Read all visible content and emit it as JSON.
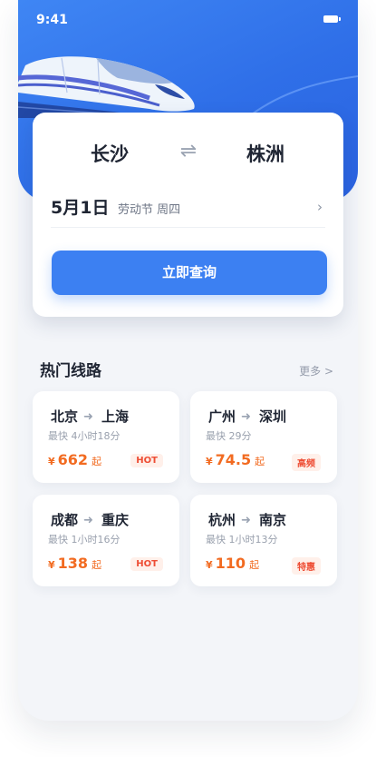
{
  "status_bar": {
    "time": "9:41"
  },
  "search": {
    "from_city": "长沙",
    "to_city": "株洲",
    "date": "5月1日",
    "date_note": "劳动节 周四",
    "search_button_label": "立即查询"
  },
  "popular": {
    "title": "热门线路",
    "more_label": "更多 >",
    "routes": [
      {
        "from": "北京",
        "to": "上海",
        "fastest": "最快 4小时18分",
        "currency": "¥",
        "price": "662",
        "price_suffix": "起",
        "badge": "HOT"
      },
      {
        "from": "广州",
        "to": "深圳",
        "fastest": "最快 29分",
        "currency": "¥",
        "price": "74.5",
        "price_suffix": "起",
        "badge": "高频"
      },
      {
        "from": "成都",
        "to": "重庆",
        "fastest": "最快 1小时16分",
        "currency": "¥",
        "price": "138",
        "price_suffix": "起",
        "badge": "HOT"
      },
      {
        "from": "杭州",
        "to": "南京",
        "fastest": "最快 1小时13分",
        "currency": "¥",
        "price": "110",
        "price_suffix": "起",
        "badge": "特惠"
      }
    ]
  },
  "icons": {
    "battery": "battery-icon",
    "swap": "swap-icon",
    "chevron": "chevron-right-icon",
    "route_arrow": "arrow-right-icon"
  },
  "colors": {
    "primary": "#3c80f2",
    "price": "#f26b21",
    "badge": "#ee4d34",
    "text": "#1f2533",
    "background": "#f3f5f9"
  }
}
